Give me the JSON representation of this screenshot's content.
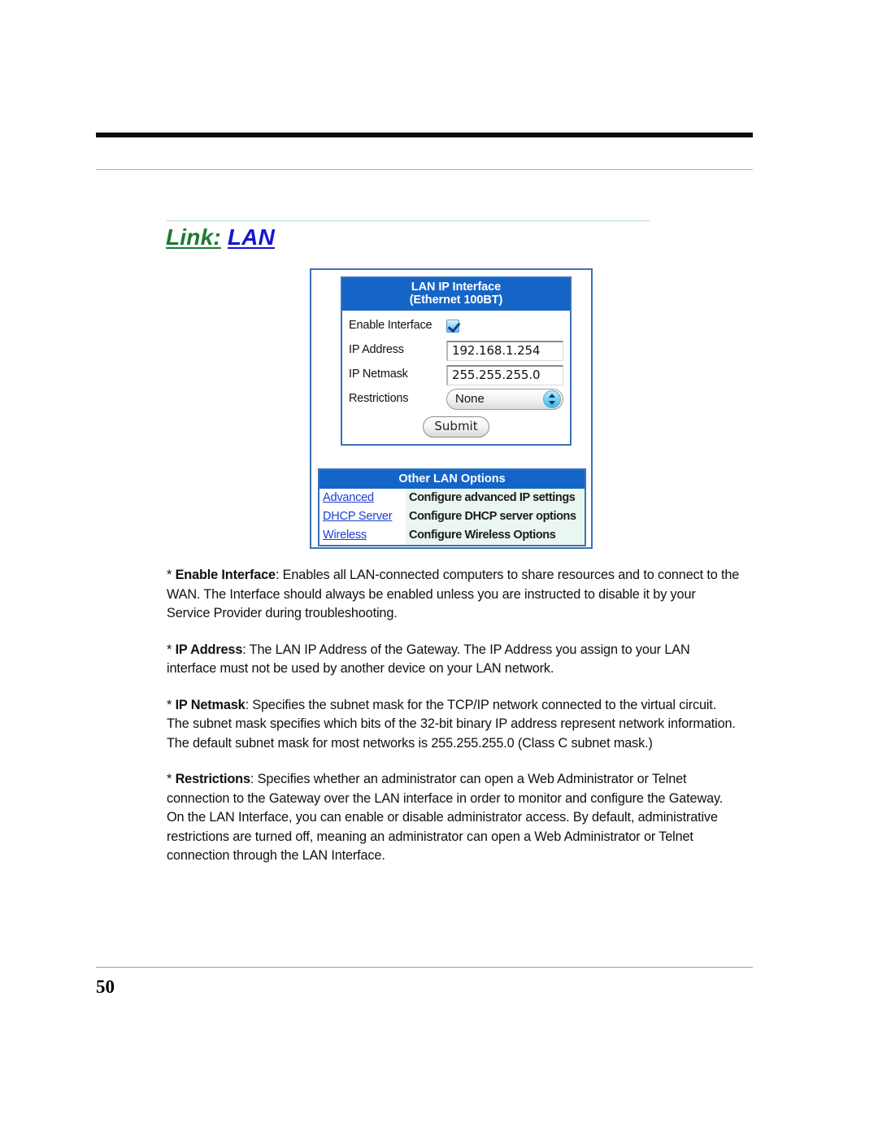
{
  "page": {
    "number": "50"
  },
  "heading": {
    "prefix": "Link:",
    "target": "LAN"
  },
  "figure": {
    "form_panel": {
      "title_line1": "LAN IP Interface",
      "title_line2": "(Ethernet 100BT)",
      "rows": {
        "enable_interface_label": "Enable Interface",
        "enable_interface_checked": "checked",
        "ip_address_label": "IP Address",
        "ip_address_value": "192.168.1.254",
        "ip_netmask_label": "IP Netmask",
        "ip_netmask_value": "255.255.255.0",
        "restrictions_label": "Restrictions",
        "restrictions_value": "None"
      },
      "submit_label": "Submit"
    },
    "options_panel": {
      "title": "Other LAN Options",
      "rows": [
        {
          "link": "Advanced",
          "description": "Configure advanced IP settings"
        },
        {
          "link": "DHCP Server",
          "description": "Configure DHCP server options"
        },
        {
          "link": "Wireless",
          "description": "Configure Wireless Options"
        }
      ]
    }
  },
  "content": {
    "paragraphs": [
      {
        "bullet": "* ",
        "term": "Enable Interface",
        "text": ": Enables all LAN-connected computers to share resources and to connect to the WAN. The Interface should always be enabled unless you are instructed to disable it by your Service Provider during troubleshooting."
      },
      {
        "bullet": "* ",
        "term": "IP Address",
        "text": ": The LAN IP Address of the Gateway. The IP Address you assign to your LAN interface must not be used by another device on your LAN network."
      },
      {
        "bullet": "* ",
        "term": "IP Netmask",
        "text": ": Specifies the subnet mask for the TCP/IP network connected to the virtual circuit. The subnet mask specifies which bits of the 32-bit binary IP address represent network information. The default subnet mask for most networks is 255.255.255.0 (Class C subnet mask.)"
      },
      {
        "bullet": "* ",
        "term": "Restrictions",
        "text": ": Specifies whether an administrator can open a Web Administrator or Telnet connection to the Gateway over the LAN interface in order to monitor and configure the Gateway. On the LAN Interface, you can enable or disable administrator access. By default, administrative restrictions are turned off, meaning an administrator can open a Web Administrator or Telnet connection through the LAN Interface."
      }
    ]
  },
  "colors": {
    "panel_header_blue": "#1565C8",
    "panel_border_blue": "#3A72B8",
    "link_blue": "#1A3FD4",
    "heading_green": "#1D7A32",
    "heading_blue": "#1414D6",
    "option_row_mint": "#EAF7F0"
  }
}
